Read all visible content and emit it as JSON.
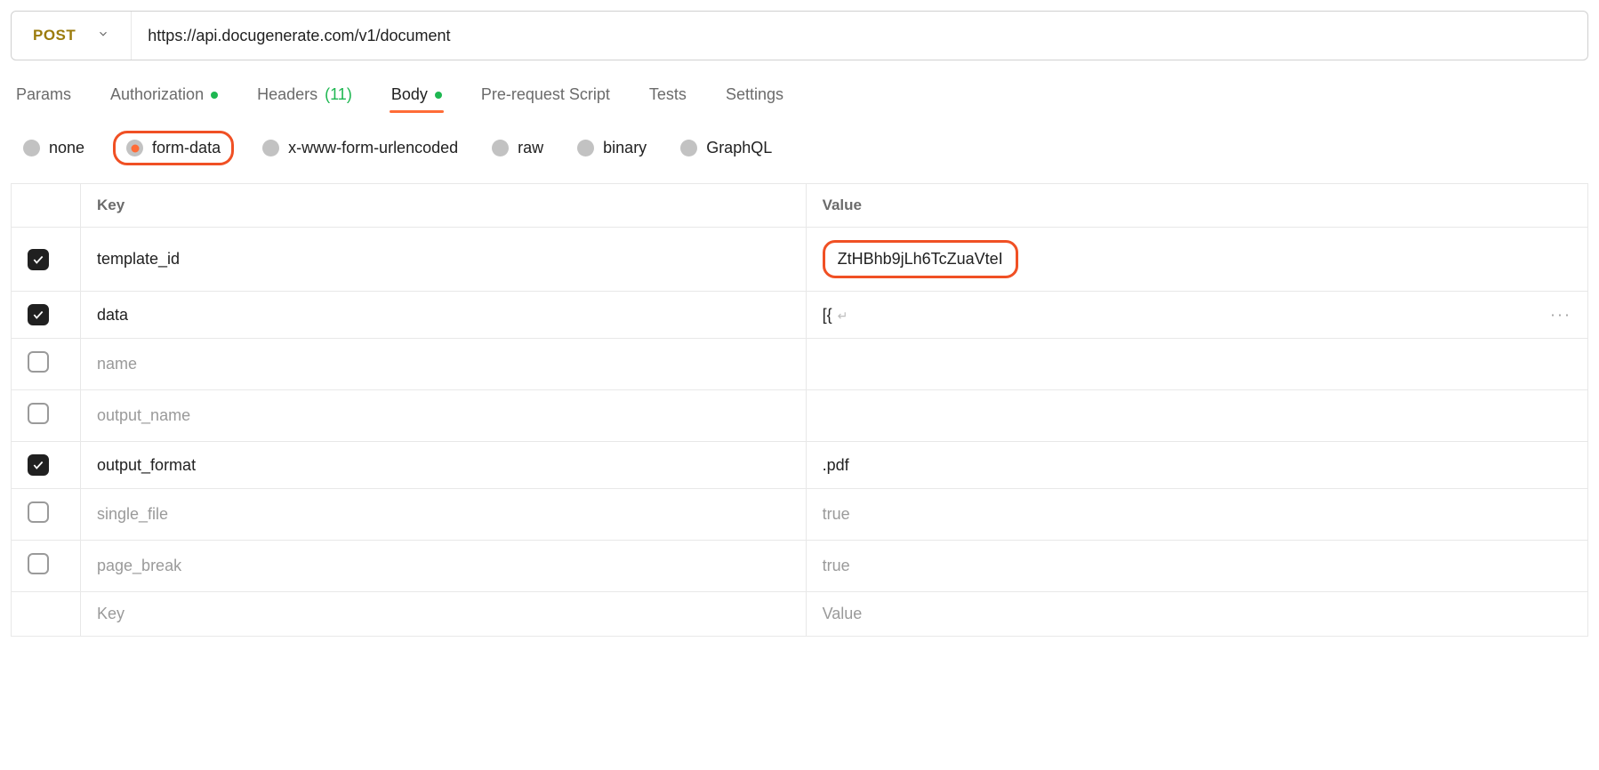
{
  "request": {
    "method": "POST",
    "url": "https://api.docugenerate.com/v1/document"
  },
  "tabs": {
    "params": "Params",
    "authorization": "Authorization",
    "headers_label": "Headers",
    "headers_count": "(11)",
    "body": "Body",
    "prerequest": "Pre-request Script",
    "tests": "Tests",
    "settings": "Settings"
  },
  "body_types": {
    "none": "none",
    "form_data": "form-data",
    "urlencoded": "x-www-form-urlencoded",
    "raw": "raw",
    "binary": "binary",
    "graphql": "GraphQL"
  },
  "table": {
    "header_key": "Key",
    "header_value": "Value",
    "rows": [
      {
        "checked": true,
        "key": "template_id",
        "value": "ZtHBhb9jLh6TcZuaVteI",
        "disabled": false,
        "highlight": true
      },
      {
        "checked": true,
        "key": "data",
        "value": "[{",
        "disabled": false,
        "is_data_row": true
      },
      {
        "checked": false,
        "key": "name",
        "value": "",
        "disabled": true
      },
      {
        "checked": false,
        "key": "output_name",
        "value": "",
        "disabled": true
      },
      {
        "checked": true,
        "key": "output_format",
        "value": ".pdf",
        "disabled": false
      },
      {
        "checked": false,
        "key": "single_file",
        "value": "true",
        "disabled": true
      },
      {
        "checked": false,
        "key": "page_break",
        "value": "true",
        "disabled": true
      }
    ],
    "placeholder_key": "Key",
    "placeholder_value": "Value"
  }
}
